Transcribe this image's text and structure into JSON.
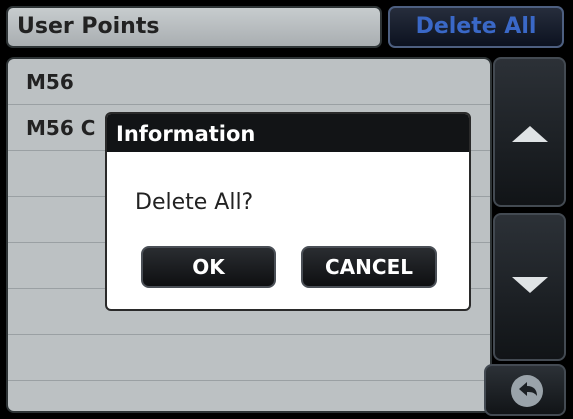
{
  "header": {
    "title": "User Points",
    "delete_all_label": "Delete All"
  },
  "list": {
    "items": [
      "M56",
      "M56 C",
      "",
      "",
      "",
      "",
      ""
    ]
  },
  "dialog": {
    "title": "Information",
    "message": "Delete All?",
    "ok_label": "OK",
    "cancel_label": "CANCEL"
  },
  "icons": {
    "scroll_up": "triangle-up-icon",
    "scroll_down": "triangle-down-icon",
    "back": "back-arrow-icon"
  },
  "colors": {
    "accent_text": "#3a68c7",
    "background": "#000000",
    "list_bg": "#bcc1c3"
  }
}
